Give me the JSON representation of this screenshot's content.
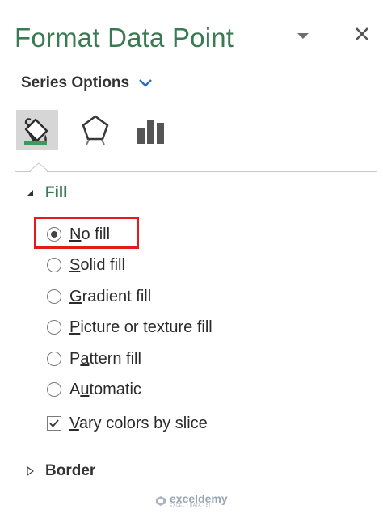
{
  "pane": {
    "title": "Format Data Point",
    "series_options_label": "Series Options"
  },
  "tabs": [
    {
      "icon": "fill-line-bucket-icon",
      "selected": true
    },
    {
      "icon": "effects-pentagon-icon",
      "selected": false
    },
    {
      "icon": "series-options-bar-chart-icon",
      "selected": false
    }
  ],
  "fill_section": {
    "label": "Fill",
    "expanded": true,
    "options": [
      {
        "label": "No fill",
        "access_key": "N",
        "rest": "o fill",
        "checked": true
      },
      {
        "label": "Solid fill",
        "access_key": "S",
        "rest": "olid fill",
        "checked": false
      },
      {
        "label": "Gradient fill",
        "access_key": "G",
        "rest": "radient fill",
        "checked": false
      },
      {
        "label": "Picture or texture fill",
        "access_key": "P",
        "rest": "icture or texture fill",
        "checked": false
      },
      {
        "label": "Pattern fill",
        "access_key": "A",
        "prefix": "P",
        "key": "a",
        "suffix": "ttern fill",
        "checked": false
      },
      {
        "label": "Automatic",
        "access_key": "U",
        "prefix": "A",
        "key": "u",
        "suffix": "tomatic",
        "checked": false
      }
    ],
    "vary_colors": {
      "access_key": "V",
      "rest": "ary colors by slice",
      "checked": true
    }
  },
  "border_section": {
    "label": "Border",
    "expanded": false
  },
  "watermark": {
    "name": "exceldemy",
    "tagline": "EXCEL · DATA · BI"
  },
  "colors": {
    "accent_green": "#3a7a53",
    "highlight_red": "#e21b1b",
    "tab_selected_bg": "#d6d6d6"
  }
}
